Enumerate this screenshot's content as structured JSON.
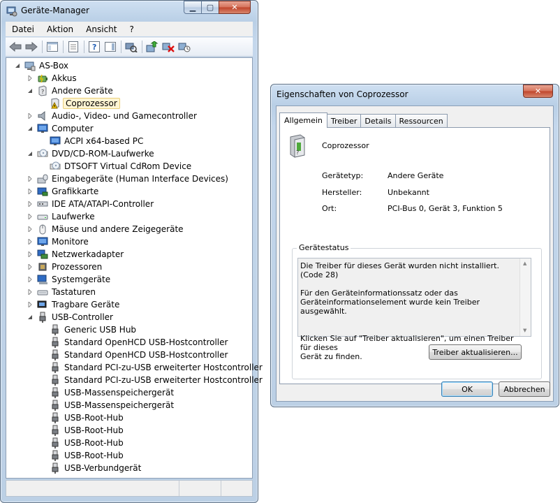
{
  "devmgr": {
    "title": "Geräte-Manager",
    "menu": [
      "Datei",
      "Aktion",
      "Ansicht",
      "?"
    ],
    "tree": [
      {
        "label": "AS-Box",
        "level": 0,
        "expander": "open",
        "icon": "computer-root-icon"
      },
      {
        "label": "Akkus",
        "level": 1,
        "expander": "closed",
        "icon": "battery-icon"
      },
      {
        "label": "Andere Geräte",
        "level": 1,
        "expander": "open",
        "icon": "unknown-device-icon"
      },
      {
        "label": "Coprozessor",
        "level": 2,
        "expander": "none",
        "icon": "warning-device-icon",
        "selected": true
      },
      {
        "label": "Audio-, Video- und Gamecontroller",
        "level": 1,
        "expander": "closed",
        "icon": "speaker-icon"
      },
      {
        "label": "Computer",
        "level": 1,
        "expander": "open",
        "icon": "monitor-icon"
      },
      {
        "label": "ACPI x64-based PC",
        "level": 2,
        "expander": "none",
        "icon": "monitor-icon"
      },
      {
        "label": "DVD/CD-ROM-Laufwerke",
        "level": 1,
        "expander": "open",
        "icon": "cdrom-icon"
      },
      {
        "label": "DTSOFT Virtual CdRom Device",
        "level": 2,
        "expander": "none",
        "icon": "cdrom-icon"
      },
      {
        "label": "Eingabegeräte (Human Interface Devices)",
        "level": 1,
        "expander": "closed",
        "icon": "hid-icon"
      },
      {
        "label": "Grafikkarte",
        "level": 1,
        "expander": "closed",
        "icon": "display-adapter-icon"
      },
      {
        "label": "IDE ATA/ATAPI-Controller",
        "level": 1,
        "expander": "closed",
        "icon": "ide-icon"
      },
      {
        "label": "Laufwerke",
        "level": 1,
        "expander": "closed",
        "icon": "disk-drive-icon"
      },
      {
        "label": "Mäuse und andere Zeigegeräte",
        "level": 1,
        "expander": "closed",
        "icon": "mouse-icon"
      },
      {
        "label": "Monitore",
        "level": 1,
        "expander": "closed",
        "icon": "monitor-icon"
      },
      {
        "label": "Netzwerkadapter",
        "level": 1,
        "expander": "closed",
        "icon": "network-icon"
      },
      {
        "label": "Prozessoren",
        "level": 1,
        "expander": "closed",
        "icon": "cpu-icon"
      },
      {
        "label": "Systemgeräte",
        "level": 1,
        "expander": "closed",
        "icon": "system-device-icon"
      },
      {
        "label": "Tastaturen",
        "level": 1,
        "expander": "closed",
        "icon": "keyboard-icon"
      },
      {
        "label": "Tragbare Geräte",
        "level": 1,
        "expander": "closed",
        "icon": "portable-device-icon"
      },
      {
        "label": "USB-Controller",
        "level": 1,
        "expander": "open",
        "icon": "usb-icon"
      },
      {
        "label": "Generic USB Hub",
        "level": 2,
        "expander": "none",
        "icon": "usb-icon"
      },
      {
        "label": "Standard OpenHCD USB-Hostcontroller",
        "level": 2,
        "expander": "none",
        "icon": "usb-icon"
      },
      {
        "label": "Standard OpenHCD USB-Hostcontroller",
        "level": 2,
        "expander": "none",
        "icon": "usb-icon"
      },
      {
        "label": "Standard PCI-zu-USB erweiterter Hostcontroller",
        "level": 2,
        "expander": "none",
        "icon": "usb-icon"
      },
      {
        "label": "Standard PCI-zu-USB erweiterter Hostcontroller",
        "level": 2,
        "expander": "none",
        "icon": "usb-icon"
      },
      {
        "label": "USB-Massenspeichergerät",
        "level": 2,
        "expander": "none",
        "icon": "usb-icon"
      },
      {
        "label": "USB-Massenspeichergerät",
        "level": 2,
        "expander": "none",
        "icon": "usb-icon"
      },
      {
        "label": "USB-Root-Hub",
        "level": 2,
        "expander": "none",
        "icon": "usb-icon"
      },
      {
        "label": "USB-Root-Hub",
        "level": 2,
        "expander": "none",
        "icon": "usb-icon"
      },
      {
        "label": "USB-Root-Hub",
        "level": 2,
        "expander": "none",
        "icon": "usb-icon"
      },
      {
        "label": "USB-Root-Hub",
        "level": 2,
        "expander": "none",
        "icon": "usb-icon"
      },
      {
        "label": "USB-Verbundgerät",
        "level": 2,
        "expander": "none",
        "icon": "usb-icon"
      }
    ]
  },
  "props": {
    "title": "Eigenschaften von Coprozessor",
    "tabs": [
      "Allgemein",
      "Treiber",
      "Details",
      "Ressourcen"
    ],
    "device_name": "Coprozessor",
    "fields": [
      {
        "label": "Gerätetyp:",
        "value": "Andere Geräte"
      },
      {
        "label": "Hersteller:",
        "value": "Unbekannt"
      },
      {
        "label": "Ort:",
        "value": "PCI-Bus 0, Gerät 3, Funktion 5"
      }
    ],
    "status_group": "Gerätestatus",
    "status_paragraphs": [
      "Die Treiber für dieses Gerät wurden nicht installiert. (Code 28)",
      "Für den Geräteinformationssatz oder das\nGeräteinformationselement wurde kein Treiber ausgewählt.",
      "\nKlicken Sie auf \"Treiber aktualisieren\", um einen Treiber für dieses\nGerät zu finden."
    ],
    "update_driver_button": "Treiber aktualisieren...",
    "ok_button": "OK",
    "cancel_button": "Abbrechen"
  },
  "colors": {
    "selection_bg": "#fff5d3",
    "warning": "#f2c300",
    "close_button": "#c0442a"
  }
}
